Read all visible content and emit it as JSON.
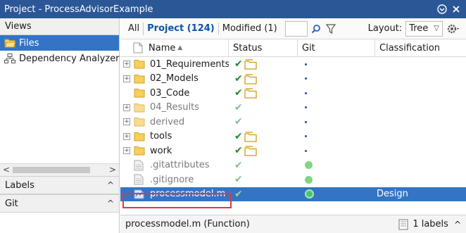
{
  "window": {
    "title": "Project - ProcessAdvisorExample"
  },
  "views": {
    "header": "Views",
    "items": [
      {
        "label": "Files",
        "icon": "folder-open-icon",
        "selected": true
      },
      {
        "label": "Dependency Analyzer",
        "icon": "dependency-icon",
        "selected": false
      }
    ]
  },
  "sections": {
    "labels": "Labels",
    "git": "Git"
  },
  "toolbar": {
    "tabs": [
      "All",
      "Project (124)",
      "Modified (1)"
    ],
    "active_tab": "Project (124)",
    "search_value": "",
    "layout_label": "Layout:",
    "layout_value": "Tree"
  },
  "columns": {
    "name": "Name",
    "status": "Status",
    "git": "Git",
    "classification": "Classification"
  },
  "rows": [
    {
      "name": "01_Requirements",
      "type": "folder",
      "expandable": true,
      "dim": false,
      "status": "✔",
      "status_folder": true,
      "git": "dot",
      "classification": ""
    },
    {
      "name": "02_Models",
      "type": "folder",
      "expandable": true,
      "dim": false,
      "status": "✔",
      "status_folder": true,
      "git": "dot",
      "classification": ""
    },
    {
      "name": "03_Code",
      "type": "folder",
      "expandable": false,
      "dim": false,
      "status": "✔",
      "status_folder": true,
      "git": "dot",
      "classification": ""
    },
    {
      "name": "04_Results",
      "type": "folder",
      "expandable": true,
      "dim": true,
      "status": "✔",
      "status_folder": false,
      "git": "dot",
      "classification": ""
    },
    {
      "name": "derived",
      "type": "folder",
      "expandable": true,
      "dim": true,
      "status": "✔",
      "status_folder": false,
      "git": "dot",
      "classification": ""
    },
    {
      "name": "tools",
      "type": "folder",
      "expandable": true,
      "dim": false,
      "status": "✔",
      "status_folder": true,
      "git": "dot",
      "classification": ""
    },
    {
      "name": "work",
      "type": "folder",
      "expandable": true,
      "dim": false,
      "status": "✔",
      "status_folder": true,
      "git": "dot",
      "classification": ""
    },
    {
      "name": ".gitattributes",
      "type": "file",
      "expandable": false,
      "dim": true,
      "status": "✔",
      "status_folder": false,
      "git": "green",
      "classification": ""
    },
    {
      "name": ".gitignore",
      "type": "file",
      "expandable": false,
      "dim": true,
      "status": "✔",
      "status_folder": false,
      "git": "green",
      "classification": ""
    },
    {
      "name": "processmodel.m",
      "type": "mfile",
      "expandable": false,
      "dim": false,
      "selected": true,
      "status": "✔",
      "status_folder": false,
      "git": "ring",
      "classification": "Design"
    }
  ],
  "statusbar": {
    "file_info": "processmodel.m (Function)",
    "labels_count": "1 labels"
  },
  "colors": {
    "titlebar": "#2b5797",
    "selection": "#3375c4",
    "accent_tab": "#0a55a8",
    "highlight": "#e0393e",
    "check": "#1f8b2a"
  }
}
